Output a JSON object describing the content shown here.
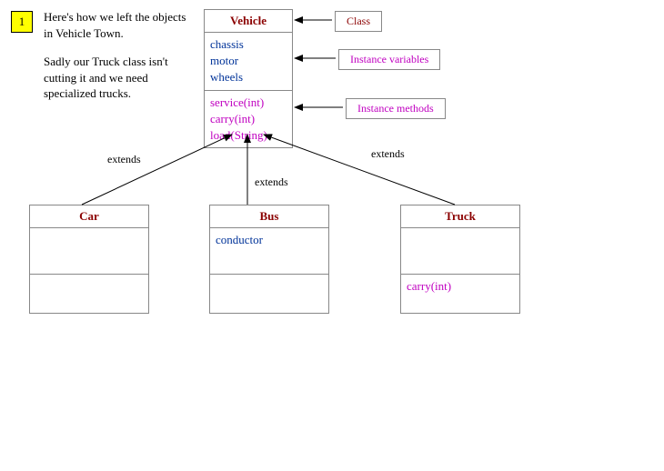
{
  "step": "1",
  "intro": {
    "p1": "Here's how we left the objects in Vehicle Town.",
    "p2": "Sadly our Truck class isn't cutting it and we need specialized trucks."
  },
  "vehicle": {
    "name": "Vehicle",
    "attr1": "chassis",
    "attr2": "motor",
    "attr3": "wheels",
    "op1": "service(int)",
    "op2": "carry(int)",
    "op3": "load(String)"
  },
  "car": {
    "name": "Car"
  },
  "bus": {
    "name": "Bus",
    "attr1": "conductor"
  },
  "truck": {
    "name": "Truck",
    "op1": "carry(int)"
  },
  "labels": {
    "class": "Class",
    "ivars": "Instance variables",
    "imethods": "Instance methods",
    "extends": "extends"
  }
}
